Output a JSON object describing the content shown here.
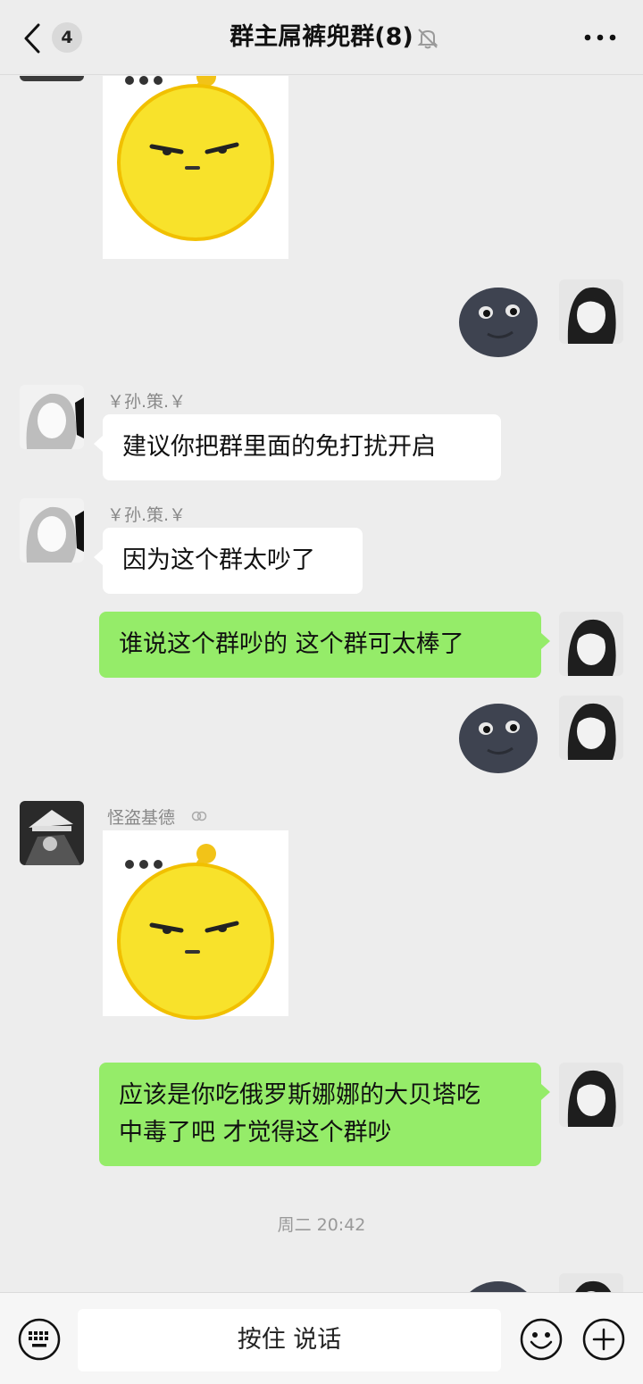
{
  "header": {
    "unread_count": "4",
    "title": "群主屌裤兜群(8)",
    "icons": {
      "back": "chevron-left-icon",
      "mute": "bell-off-icon",
      "more": "more-dots-icon"
    }
  },
  "messages": [
    {
      "type": "sticker",
      "side": "left",
      "sticker": "yellow-smirk"
    },
    {
      "type": "sticker",
      "side": "right",
      "sticker": "dark-moon-face"
    },
    {
      "type": "text",
      "side": "left",
      "sender": "￥孙.策.￥",
      "text": "建议你把群里面的免打扰开启"
    },
    {
      "type": "text",
      "side": "left",
      "sender": "￥孙.策.￥",
      "text": "因为这个群太吵了"
    },
    {
      "type": "text",
      "side": "right",
      "text": "谁说这个群吵的 这个群可太棒了"
    },
    {
      "type": "sticker",
      "side": "right",
      "sticker": "dark-moon-face"
    },
    {
      "type": "sticker",
      "side": "left",
      "sender": "怪盗基德",
      "sticker": "yellow-smirk"
    },
    {
      "type": "text",
      "side": "right",
      "text": "应该是你吃俄罗斯娜娜的大贝塔吃\n中毒了吧 才觉得这个群吵"
    },
    {
      "type": "time",
      "text": "周二 20:42"
    }
  ],
  "input": {
    "voice_label": "按住 说话",
    "icons": {
      "keyboard": "keyboard-icon",
      "emoji": "emoji-icon",
      "plus": "plus-circle-icon"
    }
  },
  "colors": {
    "background": "#ededed",
    "self_bubble": "#95ec69",
    "other_bubble": "#ffffff"
  }
}
